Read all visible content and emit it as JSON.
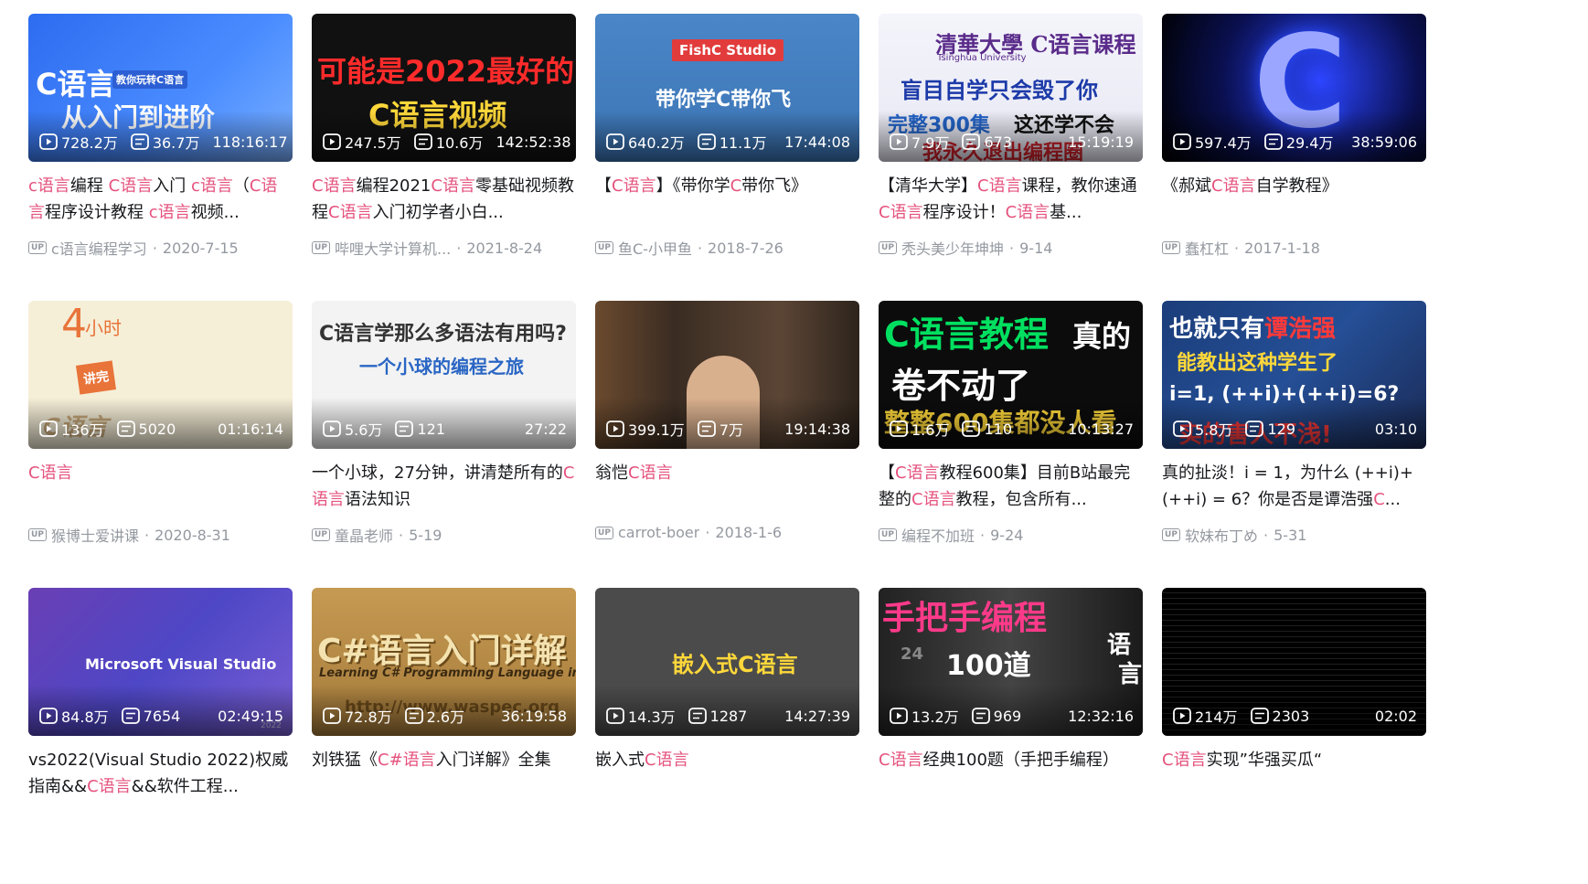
{
  "videos": [
    {
      "thumb_text": [
        "C语言",
        "从入门到进阶",
        "教你玩转C语言"
      ],
      "views": "728.2万",
      "danmaku": "36.7万",
      "duration": "118:16:17",
      "title": [
        [
          "h",
          "c语言"
        ],
        [
          "t",
          "编程 "
        ],
        [
          "h",
          "C语言"
        ],
        [
          "t",
          "入门 "
        ],
        [
          "h",
          "c语言"
        ],
        [
          "t",
          "（"
        ],
        [
          "h",
          "C语言"
        ],
        [
          "t",
          "程序设计教程 "
        ],
        [
          "h",
          "c语言"
        ],
        [
          "t",
          "视频..."
        ]
      ],
      "author": "c语言编程学习",
      "date": "2020-7-15"
    },
    {
      "thumb_text": [
        "可能是2022最好的",
        "C语言视频"
      ],
      "views": "247.5万",
      "danmaku": "10.6万",
      "duration": "142:52:38",
      "title": [
        [
          "h",
          "C语言"
        ],
        [
          "t",
          "编程2021"
        ],
        [
          "h",
          "C语言"
        ],
        [
          "t",
          "零基础视频教程"
        ],
        [
          "h",
          "C语言"
        ],
        [
          "t",
          "入门初学者小白..."
        ]
      ],
      "author": "哔哩大学计算机...",
      "date": "2021-8-24"
    },
    {
      "thumb_text": [
        "FishC Studio",
        "带你学C带你飞"
      ],
      "views": "640.2万",
      "danmaku": "11.1万",
      "duration": "17:44:08",
      "title": [
        [
          "t",
          "【"
        ],
        [
          "h",
          "C语言"
        ],
        [
          "t",
          "】《带你学"
        ],
        [
          "h",
          "C"
        ],
        [
          "t",
          "带你飞》"
        ]
      ],
      "author": "鱼C-小甲鱼",
      "date": "2018-7-26"
    },
    {
      "thumb_text": [
        "清華大學 C语言课程",
        "Tsinghua University",
        "盲目自学只会毁了你",
        "完整300集",
        "这还学不会",
        "我永久退出编程圈"
      ],
      "views": "7.9万",
      "danmaku": "673",
      "duration": "15:19:19",
      "title": [
        [
          "t",
          "【清华大学】"
        ],
        [
          "h",
          "C语言"
        ],
        [
          "t",
          "课程，教你速通"
        ],
        [
          "h",
          "C语言"
        ],
        [
          "t",
          "程序设计！"
        ],
        [
          "h",
          "C语言"
        ],
        [
          "t",
          "基..."
        ]
      ],
      "author": "秃头美少年坤坤",
      "date": "9-14"
    },
    {
      "thumb_text": [
        "C"
      ],
      "views": "597.4万",
      "danmaku": "29.4万",
      "duration": "38:59:06",
      "title": [
        [
          "t",
          "《郝斌"
        ],
        [
          "h",
          "C语言"
        ],
        [
          "t",
          "自学教程》"
        ]
      ],
      "author": "蠢杠杠",
      "date": "2017-1-18"
    },
    {
      "thumb_text": [
        "4",
        "小时",
        "讲完",
        "C语言"
      ],
      "views": "136万",
      "danmaku": "5020",
      "duration": "01:16:14",
      "title": [
        [
          "h",
          "C语言"
        ]
      ],
      "author": "猴博士爱讲课",
      "date": "2020-8-31"
    },
    {
      "thumb_text": [
        "C语言学那么多语法有用吗?",
        "一个小球的编程之旅"
      ],
      "views": "5.6万",
      "danmaku": "121",
      "duration": "27:22",
      "title": [
        [
          "t",
          "一个小球，27分钟，讲清楚所有的"
        ],
        [
          "h",
          "C语言"
        ],
        [
          "t",
          "语法知识"
        ]
      ],
      "author": "童晶老师",
      "date": "5-19"
    },
    {
      "thumb_text": [],
      "views": "399.1万",
      "danmaku": "7万",
      "duration": "19:14:38",
      "title": [
        [
          "t",
          "翁恺"
        ],
        [
          "h",
          "C语言"
        ]
      ],
      "author": "carrot-boer",
      "date": "2018-1-6"
    },
    {
      "thumb_text": [
        "C语言教程",
        "真的",
        "卷不动了",
        "整整600集都没人看"
      ],
      "views": "1.6万",
      "danmaku": "110",
      "duration": "10:13:27",
      "title": [
        [
          "t",
          "【"
        ],
        [
          "h",
          "C语言"
        ],
        [
          "t",
          "教程600集】目前B站最完整的"
        ],
        [
          "h",
          "C语言"
        ],
        [
          "t",
          "教程，包含所有..."
        ]
      ],
      "author": "编程不加班",
      "date": "9-24"
    },
    {
      "thumb_text": [
        "也就只有",
        "谭浩强",
        "能教出这种学生了",
        "i=1, (++i)+(++i)=6?",
        "实的害人不浅!"
      ],
      "views": "5.8万",
      "danmaku": "129",
      "duration": "03:10",
      "title": [
        [
          "t",
          "真的扯淡！i = 1，为什么 (++i)+(++i) = 6？你是否是谭浩强"
        ],
        [
          "h",
          "C"
        ],
        [
          "t",
          "..."
        ]
      ],
      "author": "软妹布丁め",
      "date": "5-31"
    },
    {
      "thumb_text": [
        "Microsoft Visual Studio",
        "2022"
      ],
      "views": "84.8万",
      "danmaku": "7654",
      "duration": "02:49:15",
      "title": [
        [
          "t",
          "vs2022(Visual Studio 2022)权威指南&&"
        ],
        [
          "h",
          "C语言"
        ],
        [
          "t",
          "&&软件工程..."
        ]
      ],
      "author": "",
      "date": ""
    },
    {
      "thumb_text": [
        "C#语言入门详解",
        "Learning C# Programming Language in Detail",
        "http://www.waspec.org"
      ],
      "views": "72.8万",
      "danmaku": "2.6万",
      "duration": "36:19:58",
      "title": [
        [
          "t",
          "刘铁猛《"
        ],
        [
          "h",
          "C#语言"
        ],
        [
          "t",
          "入门详解》全集"
        ]
      ],
      "author": "",
      "date": ""
    },
    {
      "thumb_text": [
        "嵌入式C语言"
      ],
      "views": "14.3万",
      "danmaku": "1287",
      "duration": "14:27:39",
      "title": [
        [
          "t",
          "嵌入式"
        ],
        [
          "h",
          "C语言"
        ]
      ],
      "author": "",
      "date": ""
    },
    {
      "thumb_text": [
        "手把手编程",
        "100道",
        "语",
        "言",
        "24"
      ],
      "views": "13.2万",
      "danmaku": "969",
      "duration": "12:32:16",
      "title": [
        [
          "h",
          "C语言"
        ],
        [
          "t",
          "经典100题（手把手编程）"
        ]
      ],
      "author": "",
      "date": ""
    },
    {
      "thumb_text": [],
      "views": "214万",
      "danmaku": "2303",
      "duration": "02:02",
      "title": [
        [
          "h",
          "C语言"
        ],
        [
          "t",
          "实现”华强买瓜“"
        ]
      ],
      "author": "",
      "date": ""
    }
  ],
  "up_label": "UP",
  "colors": {
    "highlight": "#e5527d",
    "meta": "#9499a0",
    "title": "#18191c"
  }
}
